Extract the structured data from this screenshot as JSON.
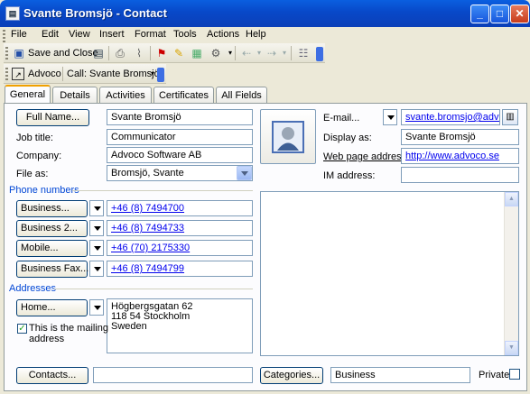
{
  "window": {
    "title": "Svante Bromsjö - Contact",
    "app_icon": "contact-card-icon"
  },
  "menu": [
    "File",
    "Edit",
    "View",
    "Insert",
    "Format",
    "Tools",
    "Actions",
    "Help"
  ],
  "toolbar": {
    "save_close": "Save and Close"
  },
  "toolbar2": {
    "advoco": "Advoco",
    "call": "Call: Svante Bromsjö"
  },
  "tabs": [
    "General",
    "Details",
    "Activities",
    "Certificates",
    "All Fields"
  ],
  "form": {
    "full_name_btn": "Full Name...",
    "full_name": "Svante Bromsjö",
    "job_title_lbl": "Job title:",
    "job_title": "Communicator",
    "company_lbl": "Company:",
    "company": "Advoco Software AB",
    "file_as_lbl": "File as:",
    "file_as": "Bromsjö, Svante"
  },
  "phone": {
    "section": "Phone numbers",
    "items": [
      {
        "label": "Business...",
        "value": "+46 (8) 7494700"
      },
      {
        "label": "Business 2...",
        "value": "+46 (8) 7494733"
      },
      {
        "label": "Mobile...",
        "value": "+46 (70) 2175330"
      },
      {
        "label": "Business Fax...",
        "value": "+46 (8) 7494799"
      }
    ]
  },
  "address": {
    "section": "Addresses",
    "type_btn": "Home...",
    "line1": "Högbergsgatan 62",
    "line2": "118 54 Stockholm",
    "line3": "Sweden",
    "mailing_line1": "This is the mailing",
    "mailing_line2": "address",
    "mailing_checked": true
  },
  "right": {
    "email_btn": "E-mail...",
    "email": "svante.bromsjo@advoco",
    "display_as_lbl": "Display as:",
    "display_as": "Svante Bromsjö",
    "web_lbl": "Web page address:",
    "web": "http://www.advoco.se",
    "im_lbl": "IM address:",
    "im": ""
  },
  "bottom": {
    "contacts_btn": "Contacts...",
    "contacts": "",
    "categories_btn": "Categories...",
    "categories": "Business",
    "private_lbl": "Private"
  }
}
